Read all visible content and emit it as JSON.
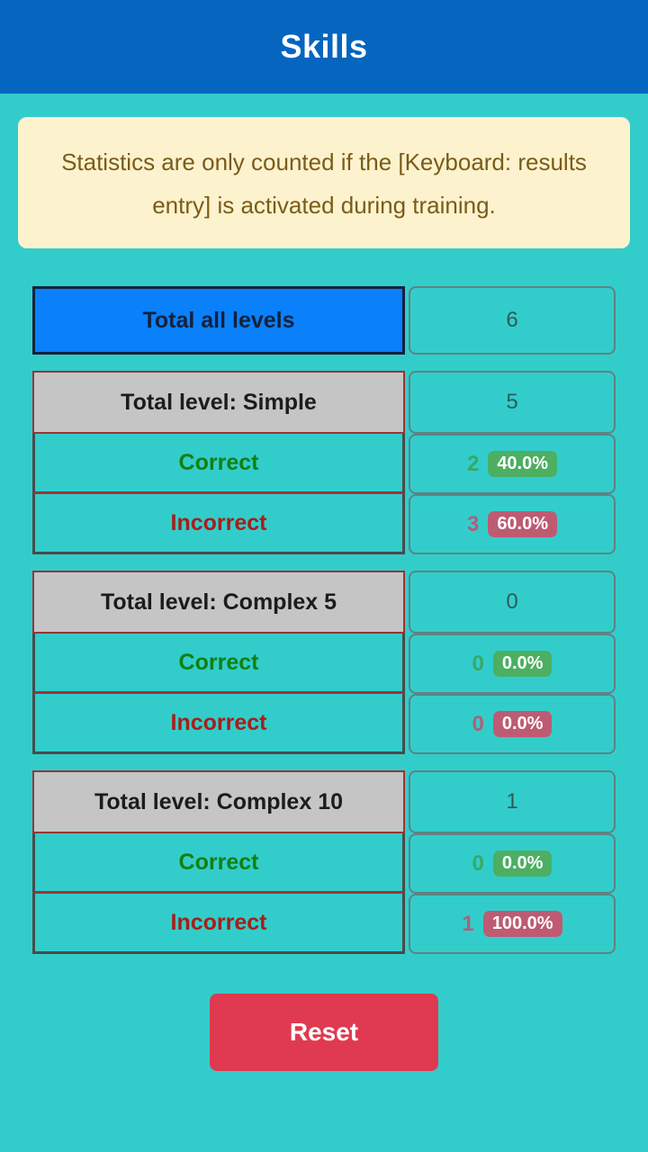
{
  "header": {
    "title": "Skills",
    "background": "#0565BF",
    "text_color": "#FFFFFF"
  },
  "theme": {
    "page_background": "#32CDCB",
    "notice_background": "#FDF2CE",
    "notice_text": "#7A5C18",
    "highlight_blue": "#0A80FB",
    "level_header_gray": "#C5C5C5",
    "correct_green": "#118011",
    "incorrect_red": "#A81E18",
    "badge_green": "#4CAF62",
    "badge_red": "#BE5B72",
    "reset_red": "#E03A50"
  },
  "notice": {
    "text": "Statistics are only counted if the [Keyboard: results entry] is activated during training."
  },
  "total": {
    "label": "Total all levels",
    "value": "6"
  },
  "groups": [
    {
      "label": "Total level: Simple",
      "value": "5",
      "correct": {
        "label": "Correct",
        "count": "2",
        "percent": "40.0%"
      },
      "incorrect": {
        "label": "Incorrect",
        "count": "3",
        "percent": "60.0%"
      }
    },
    {
      "label": "Total level: Complex 5",
      "value": "0",
      "correct": {
        "label": "Correct",
        "count": "0",
        "percent": "0.0%"
      },
      "incorrect": {
        "label": "Incorrect",
        "count": "0",
        "percent": "0.0%"
      }
    },
    {
      "label": "Total level: Complex 10",
      "value": "1",
      "correct": {
        "label": "Correct",
        "count": "0",
        "percent": "0.0%"
      },
      "incorrect": {
        "label": "Incorrect",
        "count": "1",
        "percent": "100.0%"
      }
    }
  ],
  "footer": {
    "reset_label": "Reset"
  }
}
